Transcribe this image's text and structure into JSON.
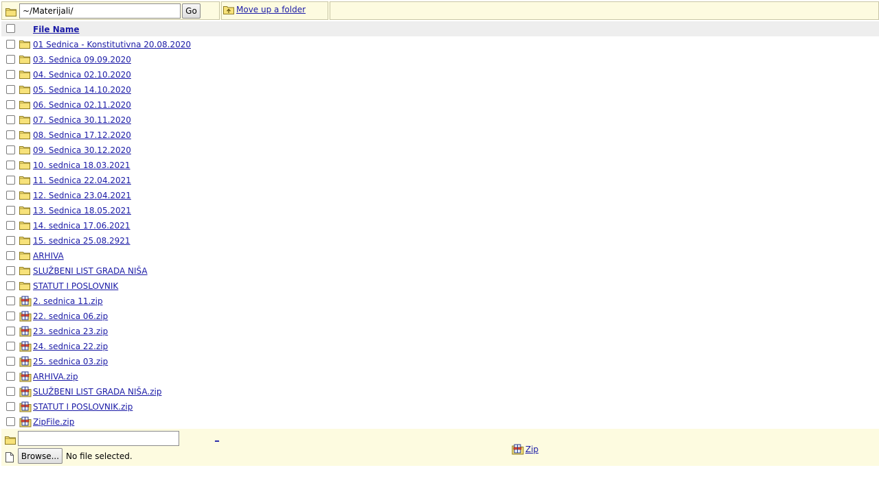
{
  "toolbar": {
    "path_value": "~/Materijali/",
    "go_label": "Go",
    "up_label": "Move up a folder"
  },
  "header": {
    "file_name_label": "File Name"
  },
  "files": [
    {
      "name": "01 Sednica - Konstitutivna 20.08.2020",
      "type": "folder"
    },
    {
      "name": "03. Sednica 09.09.2020",
      "type": "folder"
    },
    {
      "name": "04. Sednica 02.10.2020",
      "type": "folder"
    },
    {
      "name": "05. Sednica 14.10.2020",
      "type": "folder"
    },
    {
      "name": "06. Sednica 02.11.2020",
      "type": "folder"
    },
    {
      "name": "07. Sednica 30.11.2020",
      "type": "folder"
    },
    {
      "name": "08. Sednica 17.12.2020",
      "type": "folder"
    },
    {
      "name": "09. Sednica 30.12.2020",
      "type": "folder"
    },
    {
      "name": "10. sednica 18.03.2021",
      "type": "folder"
    },
    {
      "name": "11. Sednica 22.04.2021",
      "type": "folder"
    },
    {
      "name": "12. Sednica 23.04.2021",
      "type": "folder"
    },
    {
      "name": "13. Sednica 18.05.2021",
      "type": "folder"
    },
    {
      "name": "14. sednica 17.06.2021",
      "type": "folder"
    },
    {
      "name": "15. sednica 25.08.2921",
      "type": "folder"
    },
    {
      "name": "ARHIVA",
      "type": "folder"
    },
    {
      "name": "SLUŽBENI LIST GRADA NIŠA",
      "type": "folder"
    },
    {
      "name": "STATUT I POSLOVNIK",
      "type": "folder"
    },
    {
      "name": "2. sednica 11.zip",
      "type": "zip"
    },
    {
      "name": "22. sednica 06.zip",
      "type": "zip"
    },
    {
      "name": "23. sednica 23.zip",
      "type": "zip"
    },
    {
      "name": "24. sednica 22.zip",
      "type": "zip"
    },
    {
      "name": "25. sednica 03.zip",
      "type": "zip"
    },
    {
      "name": "ARHIVA.zip",
      "type": "zip"
    },
    {
      "name": "SLUŽBENI LIST GRADA NIŠA.zip",
      "type": "zip"
    },
    {
      "name": "STATUT I POSLOVNIK.zip",
      "type": "zip"
    },
    {
      "name": "ZipFile.zip",
      "type": "zip"
    }
  ],
  "bottom": {
    "new_folder_value": "",
    "create_link_label": "_",
    "browse_label": "Browse...",
    "no_file_label": "No file selected.",
    "zip_label": "Zip"
  }
}
